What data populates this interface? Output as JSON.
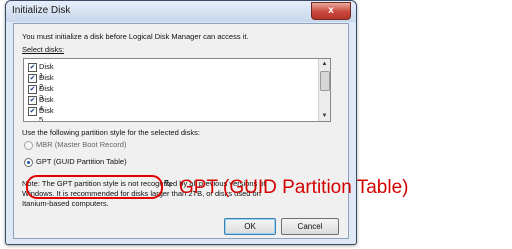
{
  "dialog": {
    "title": "Initialize Disk",
    "close_glyph": "x",
    "intro": "You must initialize a disk before Logical Disk Manager can access it.",
    "select_label": "Select disks:",
    "disks": [
      {
        "label": "Disk 1",
        "checked": true
      },
      {
        "label": "Disk 2",
        "checked": true
      },
      {
        "label": "Disk 3",
        "checked": true
      },
      {
        "label": "Disk 4",
        "checked": true
      },
      {
        "label": "Disk 5",
        "checked": true
      }
    ],
    "partition_prompt": "Use the following partition style for the selected disks:",
    "mbr_label": "MBR (Master Boot Record)",
    "gpt_label": "GPT (GUID Partition Table)",
    "selected_style": "GPT",
    "note_line1": "Note: The GPT partition style is not recognized by all previous versions of",
    "note_line2": "Windows. It is recommended for disks larger than 2TB, or disks used on",
    "note_line3": "Itanium-based computers.",
    "ok_label": "OK",
    "cancel_label": "Cancel"
  },
  "annotation": {
    "text": "GPT (GUID Partition Table)",
    "color": "#d40000"
  },
  "icons": {
    "check": "check-icon",
    "cursor": "mouse-cursor-icon"
  }
}
